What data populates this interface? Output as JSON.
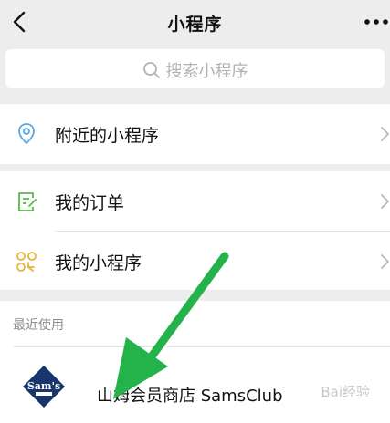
{
  "nav": {
    "title": "小程序"
  },
  "search": {
    "placeholder": "搜索小程序"
  },
  "menu": {
    "nearby": "附近的小程序",
    "orders": "我的订单",
    "my_apps": "我的小程序"
  },
  "recent": {
    "header": "最近使用",
    "items": [
      {
        "name": "山姆会员商店 SamsClub",
        "logo_text": "Sam's"
      }
    ]
  },
  "watermark": "Bai经验",
  "colors": {
    "accent_blue": "#5aa7e6",
    "accent_green": "#59b84a",
    "accent_yellow": "#e7b53d",
    "arrow_green": "#24b24a",
    "sams_navy": "#18356e"
  }
}
